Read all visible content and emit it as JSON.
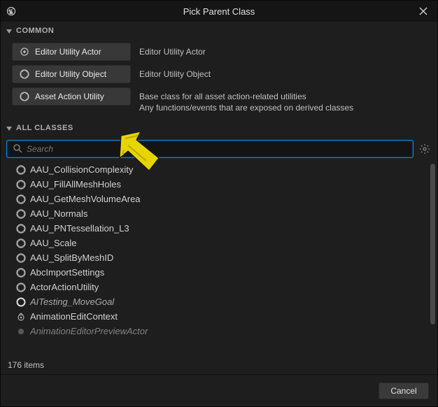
{
  "title": "Pick Parent Class",
  "sections": {
    "common_header": "COMMON",
    "all_classes_header": "ALL CLASSES"
  },
  "common": [
    {
      "label": "Editor Utility Actor",
      "desc1": "Editor Utility Actor",
      "desc2": ""
    },
    {
      "label": "Editor Utility Object",
      "desc1": "Editor Utility Object",
      "desc2": ""
    },
    {
      "label": "Asset Action Utility",
      "desc1": "Base class for all asset action-related utilities",
      "desc2": "Any functions/events that are exposed on derived classes"
    }
  ],
  "search": {
    "placeholder": "Search"
  },
  "classes": [
    "AAU_CollisionComplexity",
    "AAU_FillAllMeshHoles",
    "AAU_GetMeshVolumeArea",
    "AAU_Normals",
    "AAU_PNTessellation_L3",
    "AAU_Scale",
    "AAU_SplitByMeshID",
    "AbcImportSettings",
    "ActorActionUtility",
    "AITesting_MoveGoal",
    "AnimationEditContext",
    "AnimationEditorPreviewActor"
  ],
  "italic_index": 9,
  "cutoff_index": 11,
  "items_count": "176 items",
  "footer": {
    "cancel": "Cancel"
  }
}
